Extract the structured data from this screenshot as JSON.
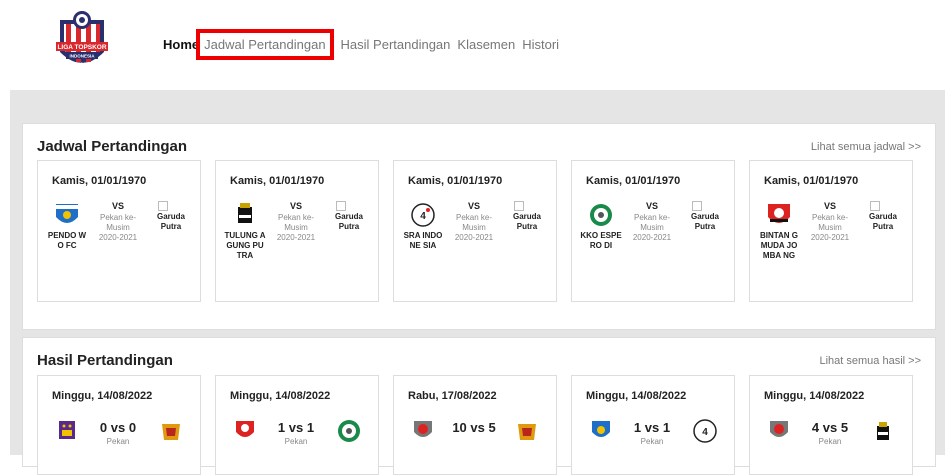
{
  "nav": {
    "home": "Home",
    "jadwal": "Jadwal Pertandingan",
    "hasil": "Hasil Pertandingan",
    "klasemen": "Klasemen",
    "histori": "Histori"
  },
  "logo": {
    "line1": "LIGA TOPSKOR",
    "line2": "INDONESIA",
    "line3": "SINCE 2017"
  },
  "jadwal": {
    "title": "Jadwal Pertandingan",
    "link": "Lihat semua jadwal >>",
    "cards": [
      {
        "date": "Kamis, 01/01/1970",
        "home": "PENDO WO FC",
        "vs": "VS",
        "meta": "Pekan ke- Musim 2020-2021",
        "away": "Garuda Putra"
      },
      {
        "date": "Kamis, 01/01/1970",
        "home": "TULUNG AGUNG PUTRA",
        "vs": "VS",
        "meta": "Pekan ke- Musim 2020-2021",
        "away": "Garuda Putra"
      },
      {
        "date": "Kamis, 01/01/1970",
        "home": "SRA INDONE SIA",
        "vs": "VS",
        "meta": "Pekan ke- Musim 2020-2021",
        "away": "Garuda Putra"
      },
      {
        "date": "Kamis, 01/01/1970",
        "home": "KKO ESPERO DI",
        "vs": "VS",
        "meta": "Pekan ke- Musim 2020-2021",
        "away": "Garuda Putra"
      },
      {
        "date": "Kamis, 01/01/1970",
        "home": "BINTAN G MUDA JOMBA NG",
        "vs": "VS",
        "meta": "Pekan ke- Musim 2020-2021",
        "away": "Garuda Putra"
      }
    ]
  },
  "hasil": {
    "title": "Hasil Pertandingan",
    "link": "Lihat semua hasil >>",
    "cards": [
      {
        "date": "Minggu, 14/08/2022",
        "score": "0 vs 0",
        "meta": "Pekan"
      },
      {
        "date": "Minggu, 14/08/2022",
        "score": "1 vs 1",
        "meta": "Pekan"
      },
      {
        "date": "Rabu, 17/08/2022",
        "score": "10 vs 5",
        "meta": ""
      },
      {
        "date": "Minggu, 14/08/2022",
        "score": "1 vs 1",
        "meta": "Pekan"
      },
      {
        "date": "Minggu, 14/08/2022",
        "score": "4 vs 5",
        "meta": "Pekan"
      }
    ]
  }
}
